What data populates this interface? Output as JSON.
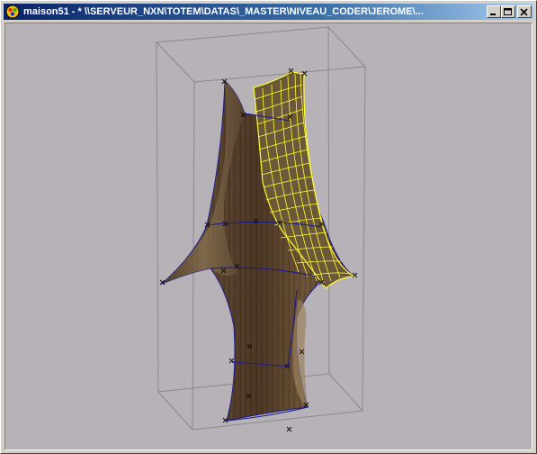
{
  "window": {
    "title": "maison51 - * \\\\SERVEUR_NXN\\TOTEM\\DATAS\\_MASTER\\NIVEAU_CODER\\JEROME\\...",
    "icon": "app-icon",
    "buttons": {
      "minimize_icon": "minimize-icon",
      "maximize_icon": "maximize-icon",
      "close_icon": "close-icon"
    }
  },
  "viewport": {
    "background": "#b7b1b8",
    "object": "3d-totem-wooden-model",
    "selected_patch_color": "#ffff33",
    "curve_color": "#1c1c8a",
    "bounding_box_color": "#8a8a8a"
  }
}
